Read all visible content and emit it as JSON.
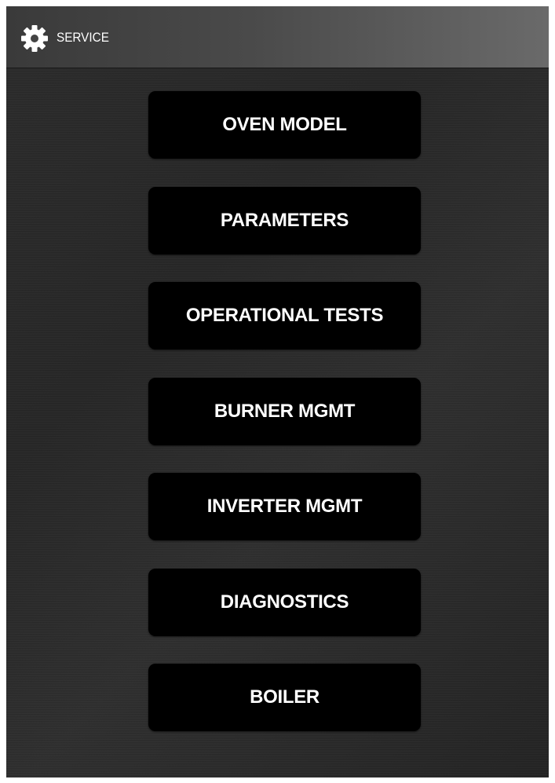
{
  "header": {
    "title": "SERVICE",
    "icon": "gear-icon"
  },
  "menu": {
    "items": [
      {
        "label": "OVEN MODEL"
      },
      {
        "label": "PARAMETERS"
      },
      {
        "label": "OPERATIONAL TESTS"
      },
      {
        "label": "BURNER MGMT"
      },
      {
        "label": "INVERTER MGMT"
      },
      {
        "label": "DIAGNOSTICS"
      },
      {
        "label": "BOILER"
      }
    ]
  },
  "colors": {
    "background": "#282828",
    "button": "#000000",
    "text": "#ffffff"
  }
}
